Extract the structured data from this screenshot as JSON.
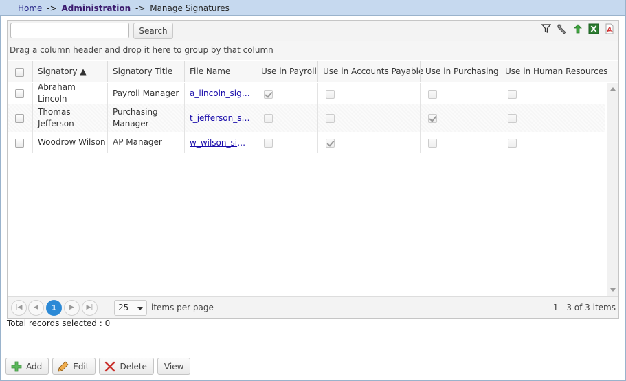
{
  "breadcrumb": {
    "home": "Home",
    "sep1": "->",
    "administration": "Administration",
    "sep2": "->",
    "current": "Manage Signatures"
  },
  "toolbar": {
    "search_value": "",
    "search_button": "Search",
    "icons": [
      "filter-icon",
      "wrench-icon",
      "refresh-export-icon",
      "excel-export-icon",
      "pdf-export-icon"
    ]
  },
  "group_hint": "Drag a column header and drop it here to group by that column",
  "columns": [
    "",
    "Signatory ▲",
    "Signatory Title",
    "File Name",
    "Use in Payroll",
    "Use in Accounts Payable",
    "Use in Purchasing",
    "Use in Human Resources"
  ],
  "rows": [
    {
      "signatory": "Abraham Lincoln",
      "title": "Payroll Manager",
      "file": "a_lincoln_signature.png",
      "payroll": true,
      "ap": false,
      "purchasing": false,
      "hr": false
    },
    {
      "signatory": "Thomas Jefferson",
      "title": "Purchasing Manager",
      "file": "t_jefferson_signature.png",
      "payroll": false,
      "ap": false,
      "purchasing": true,
      "hr": false
    },
    {
      "signatory": "Woodrow Wilson",
      "title": "AP Manager",
      "file": "w_wilson_signature.png",
      "payroll": false,
      "ap": true,
      "purchasing": false,
      "hr": false
    }
  ],
  "pager": {
    "current_page": "1",
    "page_size": "25",
    "items_per_page_label": "items per page",
    "info": "1 - 3 of 3 items"
  },
  "total_selected": "Total records selected : 0",
  "actions": {
    "add": "Add",
    "edit": "Edit",
    "delete": "Delete",
    "view": "View"
  },
  "colors": {
    "breadcrumb_bg": "#c6d9ef",
    "accent": "#2b89d6",
    "link": "#1a0dab"
  }
}
